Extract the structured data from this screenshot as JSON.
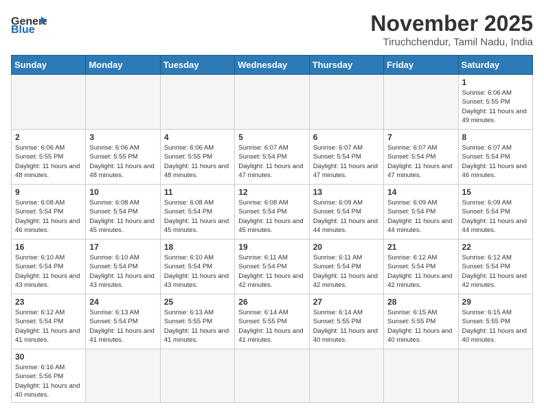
{
  "logo": {
    "general": "General",
    "blue": "Blue"
  },
  "header": {
    "month_year": "November 2025",
    "location": "Tiruchchendur, Tamil Nadu, India"
  },
  "days_of_week": [
    "Sunday",
    "Monday",
    "Tuesday",
    "Wednesday",
    "Thursday",
    "Friday",
    "Saturday"
  ],
  "weeks": [
    [
      {
        "day": "",
        "info": ""
      },
      {
        "day": "",
        "info": ""
      },
      {
        "day": "",
        "info": ""
      },
      {
        "day": "",
        "info": ""
      },
      {
        "day": "",
        "info": ""
      },
      {
        "day": "",
        "info": ""
      },
      {
        "day": "1",
        "info": "Sunrise: 6:06 AM\nSunset: 5:55 PM\nDaylight: 11 hours and 49 minutes."
      }
    ],
    [
      {
        "day": "2",
        "info": "Sunrise: 6:06 AM\nSunset: 5:55 PM\nDaylight: 11 hours and 48 minutes."
      },
      {
        "day": "3",
        "info": "Sunrise: 6:06 AM\nSunset: 5:55 PM\nDaylight: 11 hours and 48 minutes."
      },
      {
        "day": "4",
        "info": "Sunrise: 6:06 AM\nSunset: 5:55 PM\nDaylight: 11 hours and 48 minutes."
      },
      {
        "day": "5",
        "info": "Sunrise: 6:07 AM\nSunset: 5:54 PM\nDaylight: 11 hours and 47 minutes."
      },
      {
        "day": "6",
        "info": "Sunrise: 6:07 AM\nSunset: 5:54 PM\nDaylight: 11 hours and 47 minutes."
      },
      {
        "day": "7",
        "info": "Sunrise: 6:07 AM\nSunset: 5:54 PM\nDaylight: 11 hours and 47 minutes."
      },
      {
        "day": "8",
        "info": "Sunrise: 6:07 AM\nSunset: 5:54 PM\nDaylight: 11 hours and 46 minutes."
      }
    ],
    [
      {
        "day": "9",
        "info": "Sunrise: 6:08 AM\nSunset: 5:54 PM\nDaylight: 11 hours and 46 minutes."
      },
      {
        "day": "10",
        "info": "Sunrise: 6:08 AM\nSunset: 5:54 PM\nDaylight: 11 hours and 45 minutes."
      },
      {
        "day": "11",
        "info": "Sunrise: 6:08 AM\nSunset: 5:54 PM\nDaylight: 11 hours and 45 minutes."
      },
      {
        "day": "12",
        "info": "Sunrise: 6:08 AM\nSunset: 5:54 PM\nDaylight: 11 hours and 45 minutes."
      },
      {
        "day": "13",
        "info": "Sunrise: 6:09 AM\nSunset: 5:54 PM\nDaylight: 11 hours and 44 minutes."
      },
      {
        "day": "14",
        "info": "Sunrise: 6:09 AM\nSunset: 5:54 PM\nDaylight: 11 hours and 44 minutes."
      },
      {
        "day": "15",
        "info": "Sunrise: 6:09 AM\nSunset: 5:54 PM\nDaylight: 11 hours and 44 minutes."
      }
    ],
    [
      {
        "day": "16",
        "info": "Sunrise: 6:10 AM\nSunset: 5:54 PM\nDaylight: 11 hours and 43 minutes."
      },
      {
        "day": "17",
        "info": "Sunrise: 6:10 AM\nSunset: 5:54 PM\nDaylight: 11 hours and 43 minutes."
      },
      {
        "day": "18",
        "info": "Sunrise: 6:10 AM\nSunset: 5:54 PM\nDaylight: 11 hours and 43 minutes."
      },
      {
        "day": "19",
        "info": "Sunrise: 6:11 AM\nSunset: 5:54 PM\nDaylight: 11 hours and 42 minutes."
      },
      {
        "day": "20",
        "info": "Sunrise: 6:11 AM\nSunset: 5:54 PM\nDaylight: 11 hours and 42 minutes."
      },
      {
        "day": "21",
        "info": "Sunrise: 6:12 AM\nSunset: 5:54 PM\nDaylight: 11 hours and 42 minutes."
      },
      {
        "day": "22",
        "info": "Sunrise: 6:12 AM\nSunset: 5:54 PM\nDaylight: 11 hours and 42 minutes."
      }
    ],
    [
      {
        "day": "23",
        "info": "Sunrise: 6:12 AM\nSunset: 5:54 PM\nDaylight: 11 hours and 41 minutes."
      },
      {
        "day": "24",
        "info": "Sunrise: 6:13 AM\nSunset: 5:54 PM\nDaylight: 11 hours and 41 minutes."
      },
      {
        "day": "25",
        "info": "Sunrise: 6:13 AM\nSunset: 5:55 PM\nDaylight: 11 hours and 41 minutes."
      },
      {
        "day": "26",
        "info": "Sunrise: 6:14 AM\nSunset: 5:55 PM\nDaylight: 11 hours and 41 minutes."
      },
      {
        "day": "27",
        "info": "Sunrise: 6:14 AM\nSunset: 5:55 PM\nDaylight: 11 hours and 40 minutes."
      },
      {
        "day": "28",
        "info": "Sunrise: 6:15 AM\nSunset: 5:55 PM\nDaylight: 11 hours and 40 minutes."
      },
      {
        "day": "29",
        "info": "Sunrise: 6:15 AM\nSunset: 5:55 PM\nDaylight: 11 hours and 40 minutes."
      }
    ],
    [
      {
        "day": "30",
        "info": "Sunrise: 6:16 AM\nSunset: 5:56 PM\nDaylight: 11 hours and 40 minutes."
      },
      {
        "day": "",
        "info": ""
      },
      {
        "day": "",
        "info": ""
      },
      {
        "day": "",
        "info": ""
      },
      {
        "day": "",
        "info": ""
      },
      {
        "day": "",
        "info": ""
      },
      {
        "day": "",
        "info": ""
      }
    ]
  ]
}
